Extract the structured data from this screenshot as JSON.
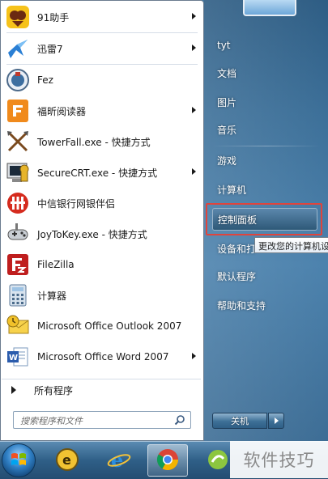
{
  "programs": [
    {
      "label": "91助手",
      "has_submenu": true,
      "icon": "91-assistant-icon"
    },
    {
      "label": "迅雷7",
      "has_submenu": true,
      "icon": "thunder-bird-icon"
    },
    {
      "label": "Fez",
      "has_submenu": false,
      "icon": "fez-icon"
    },
    {
      "label": "福昕阅读器",
      "has_submenu": true,
      "icon": "foxit-pdf-icon"
    },
    {
      "label": "TowerFall.exe - 快捷方式",
      "has_submenu": false,
      "icon": "crossed-arrows-icon"
    },
    {
      "label": "SecureCRT.exe - 快捷方式",
      "has_submenu": true,
      "icon": "securecrt-icon"
    },
    {
      "label": "中信银行网银伴侣",
      "has_submenu": false,
      "icon": "citic-bank-icon"
    },
    {
      "label": "JoyToKey.exe - 快捷方式",
      "has_submenu": false,
      "icon": "gamepad-icon"
    },
    {
      "label": "FileZilla",
      "has_submenu": false,
      "icon": "filezilla-icon"
    },
    {
      "label": "计算器",
      "has_submenu": false,
      "icon": "calculator-icon"
    },
    {
      "label": "Microsoft Office Outlook 2007",
      "has_submenu": false,
      "icon": "outlook-icon"
    },
    {
      "label": "Microsoft Office Word 2007",
      "has_submenu": true,
      "icon": "word-icon"
    }
  ],
  "all_programs_label": "所有程序",
  "search": {
    "placeholder": "搜索程序和文件"
  },
  "right": {
    "user": "tyt",
    "documents": "文档",
    "pictures": "图片",
    "music": "音乐",
    "games": "游戏",
    "computer": "计算机",
    "control_panel": "控制面板",
    "devices": "设备和打",
    "default_programs": "默认程序",
    "help": "帮助和支持"
  },
  "tooltip": "更改您的计算机设",
  "shutdown_label": "关机",
  "watermark": "软件技巧",
  "colors": {
    "highlight_box": "#e0443c",
    "menu_right": "#3c6f98"
  }
}
